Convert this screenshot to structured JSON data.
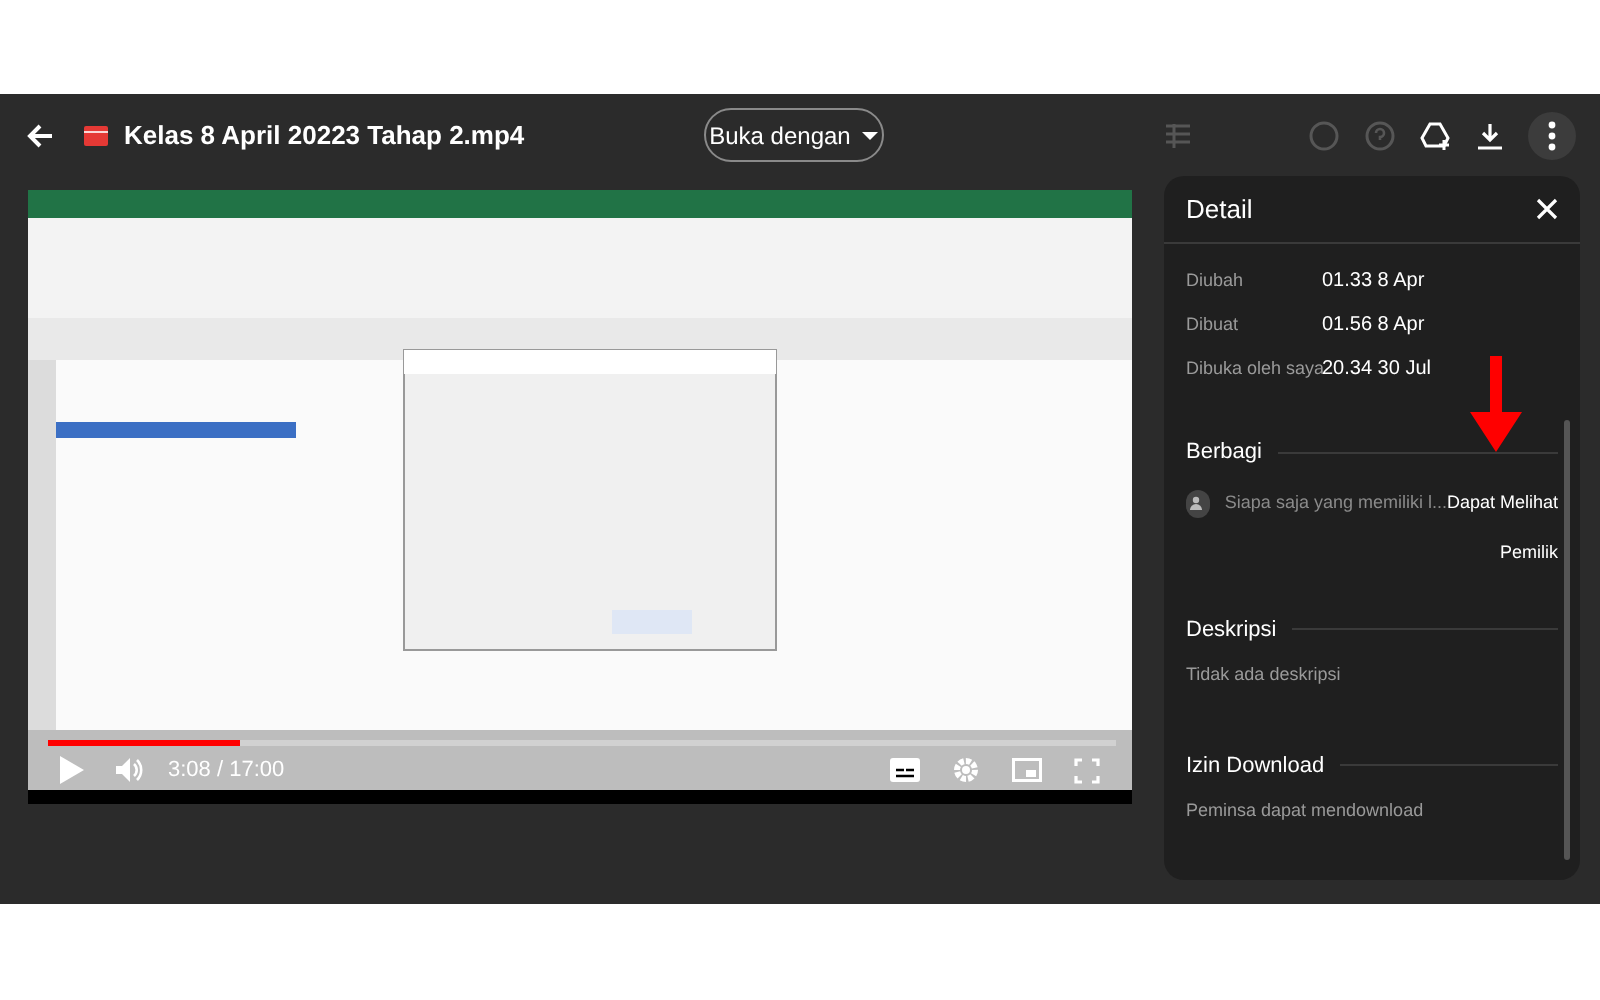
{
  "top_bar": {
    "title": "Kelas 8 April 20223 Tahap 2.mp4",
    "open_with": "Buka dengan"
  },
  "player": {
    "progress": {
      "level": 0.18
    },
    "time": "3:08 / 17:00"
  },
  "detail": {
    "title": "Detail",
    "properties": [
      {
        "label": "Diubah",
        "value": "01.33 8 Apr"
      },
      {
        "label": "Dibuat",
        "value": "01.56 8 Apr"
      },
      {
        "label": "Dibuka oleh saya",
        "value": "20.34 30 Jul"
      }
    ],
    "sharing": {
      "heading": "Berbagi",
      "entries": [
        {
          "who": "Siapa saja yang memiliki l...",
          "role": "Dapat Melihat"
        },
        {
          "role": "Pemilik"
        }
      ]
    },
    "description": {
      "heading": "Deskripsi",
      "text": "Tidak ada deskripsi"
    },
    "download": {
      "heading": "Izin Download",
      "text": "Peminsa dapat mendownload"
    }
  }
}
